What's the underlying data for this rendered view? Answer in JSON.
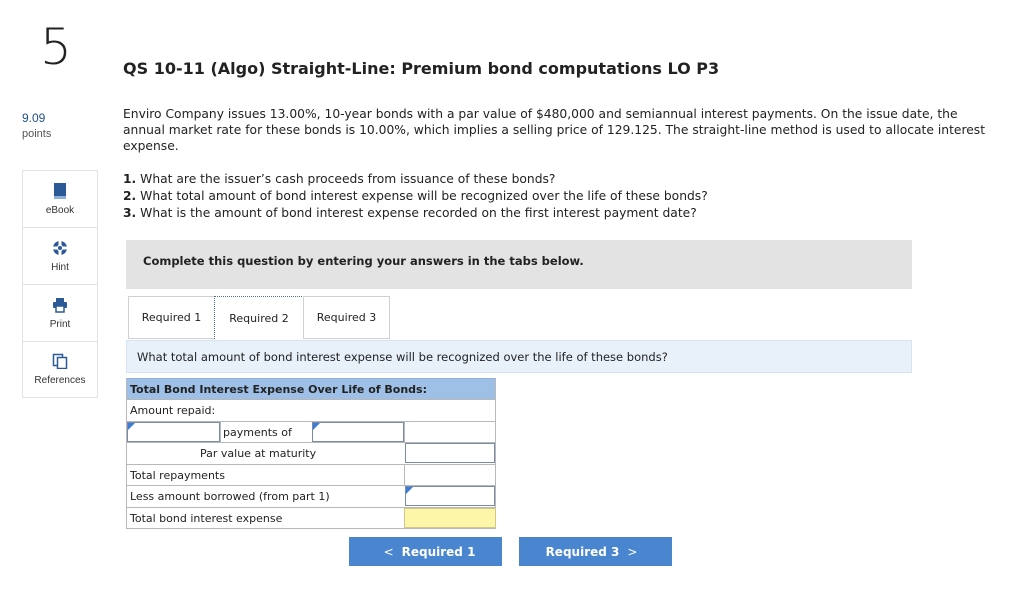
{
  "question": {
    "number": "5",
    "points_value": "9.09",
    "points_label": "points"
  },
  "sidebar": {
    "items": [
      {
        "label": "eBook",
        "icon": "book-icon"
      },
      {
        "label": "Hint",
        "icon": "lifebuoy-icon"
      },
      {
        "label": "Print",
        "icon": "printer-icon"
      },
      {
        "label": "References",
        "icon": "documents-icon"
      }
    ]
  },
  "title": "QS 10-11 (Algo) Straight-Line: Premium bond computations LO P3",
  "intro": "Enviro Company issues 13.00%, 10-year bonds with a par value of $480,000 and semiannual interest payments. On the issue date, the annual market rate for these bonds is 10.00%, which implies a selling price of 129.125. The straight-line method is used to allocate interest expense.",
  "questions": [
    {
      "num": "1.",
      "text": "What are the issuer’s cash proceeds from issuance of these bonds?"
    },
    {
      "num": "2.",
      "text": "What total amount of bond interest expense will be recognized over the life of these bonds?"
    },
    {
      "num": "3.",
      "text": "What is the amount of bond interest expense recorded on the first interest payment date?"
    }
  ],
  "instruction": "Complete this question by entering your answers in the tabs below.",
  "tabs": [
    {
      "label": "Required 1"
    },
    {
      "label": "Required 2"
    },
    {
      "label": "Required 3"
    }
  ],
  "active_question": "What total amount of bond interest expense will be recognized over the life of these bonds?",
  "table": {
    "header": "Total Bond Interest Expense Over Life of Bonds:",
    "amount_repaid": "Amount repaid:",
    "payments_of": "payments of",
    "par_value": "Par value at maturity",
    "total_repayments": "Total repayments",
    "less_borrowed": "Less amount borrowed (from part 1)",
    "total_interest": "Total bond interest expense"
  },
  "nav": {
    "prev_label": "Required 1",
    "next_label": "Required 3",
    "prev_chevron": "<",
    "next_chevron": ">"
  },
  "colors": {
    "accent": "#4a86cf",
    "header_blue": "#9ec0e6",
    "highlight": "#fdf6a8"
  }
}
